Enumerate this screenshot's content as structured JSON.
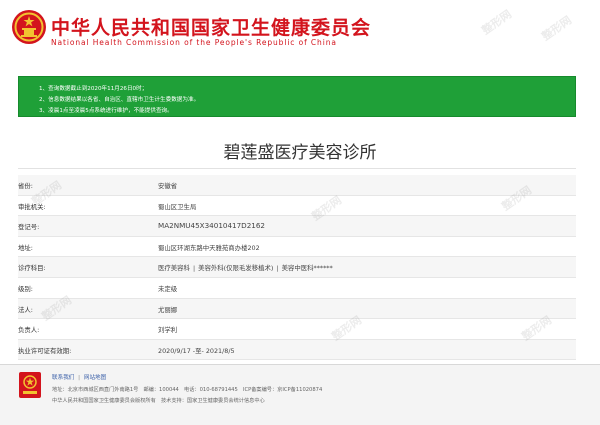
{
  "header": {
    "cn_title": "中华人民共和国国家卫生健康委员会",
    "en_title": "National Health Commission of the People's Republic of China"
  },
  "notice": {
    "lines": [
      "1、查询数据截止到2020年11月26日0时；",
      "2、信息数据结果以各省、自治区、直辖市卫生计生委数据为准。",
      "3、凌晨1点至凌晨5点系统进行维护，不能提供查询。"
    ]
  },
  "page_title": "碧莲盛医疗美容诊所",
  "info": [
    {
      "label": "省份:",
      "value": "安徽省"
    },
    {
      "label": "审批机关:",
      "value": "蜀山区卫生局"
    },
    {
      "label": "登记号:",
      "value": "MA2NMU45X34010417D2162"
    },
    {
      "label": "地址:",
      "value": "蜀山区环湖东路中天雅苑商办楼202"
    },
    {
      "label": "诊疗科目:",
      "subjects": [
        "医疗美容科",
        "美容外科(仅限毛发移植术)",
        "美容中医科******"
      ]
    },
    {
      "label": "级别:",
      "value": "未定级"
    },
    {
      "label": "法人:",
      "value": "尤丽娜"
    },
    {
      "label": "负责人:",
      "value": "刘学利"
    },
    {
      "label": "执业许可证有效期:",
      "value": "2020/9/17 -至- 2021/8/5"
    }
  ],
  "footer": {
    "links": [
      "联系我们",
      "网站地图"
    ],
    "address": "地址：北京市西城区西直门外南路1号　邮编：100044　电话：010-68791445　ICP备案编号：京ICP备11020874",
    "sponsor": "中华人民共和国国家卫生健康委员会版权所有　技术支持：国家卫生健康委员会统计信息中心"
  },
  "watermark": "整形网"
}
